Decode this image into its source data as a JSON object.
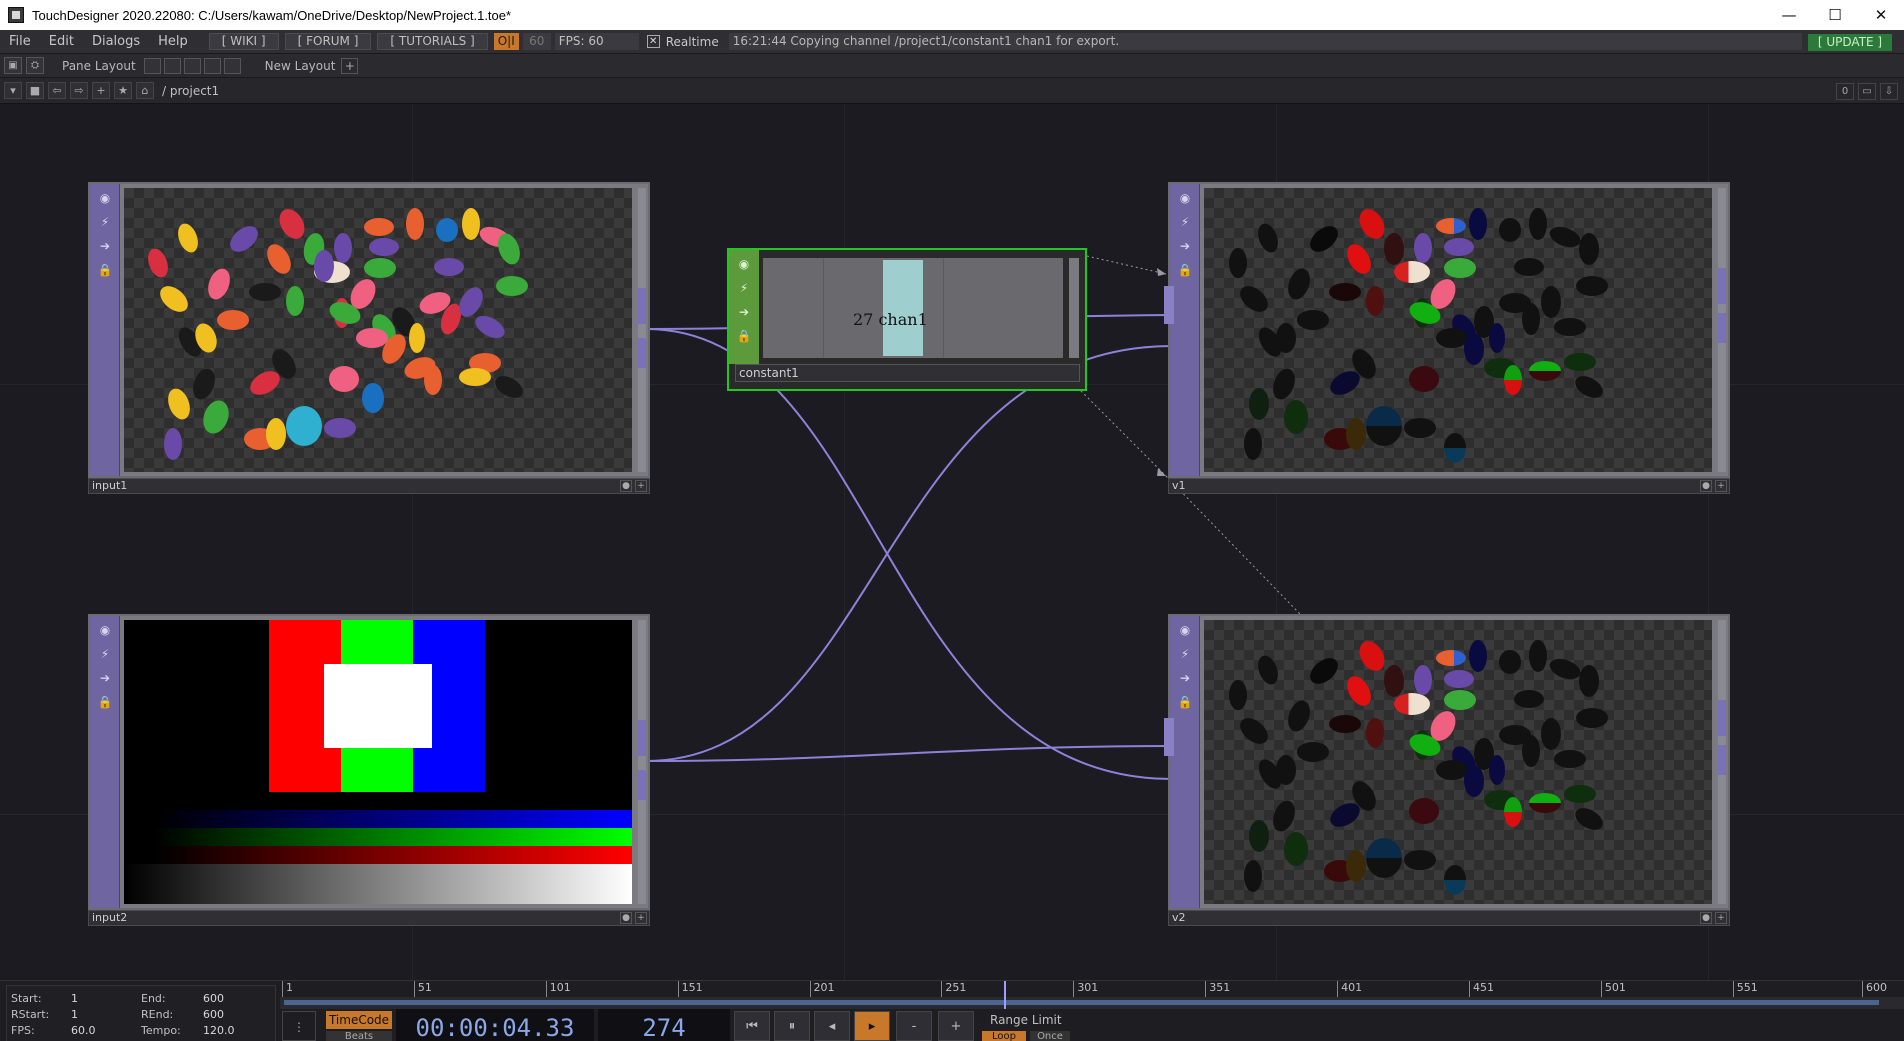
{
  "window": {
    "title": "TouchDesigner 2020.22080: C:/Users/kawam/OneDrive/Desktop/NewProject.1.toe*",
    "minimize": "—",
    "maximize": "☐",
    "close": "✕"
  },
  "menubar": {
    "items": [
      "File",
      "Edit",
      "Dialogs",
      "Help"
    ],
    "wiki": "[ WIKI ]",
    "forum": "[ FORUM ]",
    "tutorials": "[ TUTORIALS ]",
    "oi": "O|I",
    "fps_cap": "60",
    "fps": "FPS:  60",
    "realtime_label": "Realtime",
    "realtime_checked": "✕",
    "status": "16:21:44 Copying channel /project1/constant1 chan1 for export.",
    "update": "[ UPDATE ]"
  },
  "panebar": {
    "pane_layout": "Pane Layout",
    "new_layout": "New Layout",
    "plus": "+"
  },
  "pathbar": {
    "path": "/ project1",
    "right_num": "0"
  },
  "nodes": {
    "input1": {
      "name": "input1"
    },
    "input2": {
      "name": "input2"
    },
    "v1": {
      "name": "v1"
    },
    "v2": {
      "name": "v2"
    },
    "constant1": {
      "name": "constant1",
      "value": "27",
      "channel": "chan1"
    }
  },
  "colors": {
    "accent_purple": "#6f65a0",
    "wire": "#8e82d8",
    "selected_green": "#22c822",
    "timeline_orange": "#c8782b"
  },
  "timeline": {
    "ticks": [
      "1",
      "51",
      "101",
      "151",
      "201",
      "251",
      "301",
      "351",
      "401",
      "451",
      "501",
      "551",
      "600"
    ],
    "start_label": "Start:",
    "start": "1",
    "end_label": "End:",
    "end": "600",
    "rstart_label": "RStart:",
    "rstart": "1",
    "rend_label": "REnd:",
    "rend": "600",
    "fps_label": "FPS:",
    "fps": "60.0",
    "tempo_label": "Tempo:",
    "tempo": "120.0",
    "timecode_btn": "TimeCode",
    "beats_btn": "Beats",
    "timecode": "00:00:04.33",
    "frame": "274",
    "current_frame_fraction": 0.456,
    "range_limit": "Range Limit",
    "loop": "Loop",
    "once": "Once",
    "btn_first": "⏮",
    "btn_pause": "⏸",
    "btn_back": "◂",
    "btn_play": "▸",
    "btn_minus": "-",
    "btn_plus": "+"
  }
}
